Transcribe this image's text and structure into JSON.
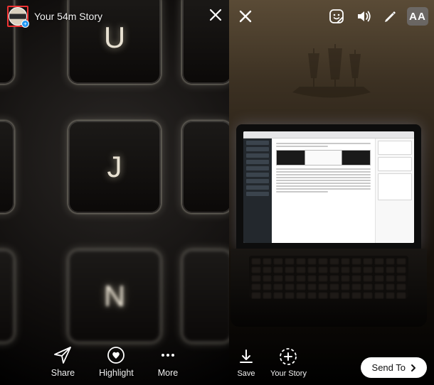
{
  "left": {
    "header_text": "Your 54m Story",
    "avatar_badge_glyph": "+",
    "keys": {
      "u": "U",
      "j": "J",
      "n": "N"
    },
    "bottom": {
      "share": "Share",
      "highlight": "Highlight",
      "more": "More"
    }
  },
  "right": {
    "toolbar": {
      "text_tool_label": "AA"
    },
    "bottom": {
      "save": "Save",
      "your_story": "Your Story",
      "send_to": "Send To"
    }
  },
  "icons": {
    "close": "close-icon",
    "share_plane": "paper-plane-icon",
    "highlight_heart": "heart-circle-icon",
    "more_dots": "more-icon",
    "sticker": "sticker-icon",
    "sound": "sound-icon",
    "draw": "pencil-icon",
    "text_tool": "text-tool-icon",
    "download": "download-icon",
    "add_story": "add-story-icon",
    "chevron_right": "chevron-right-icon"
  }
}
